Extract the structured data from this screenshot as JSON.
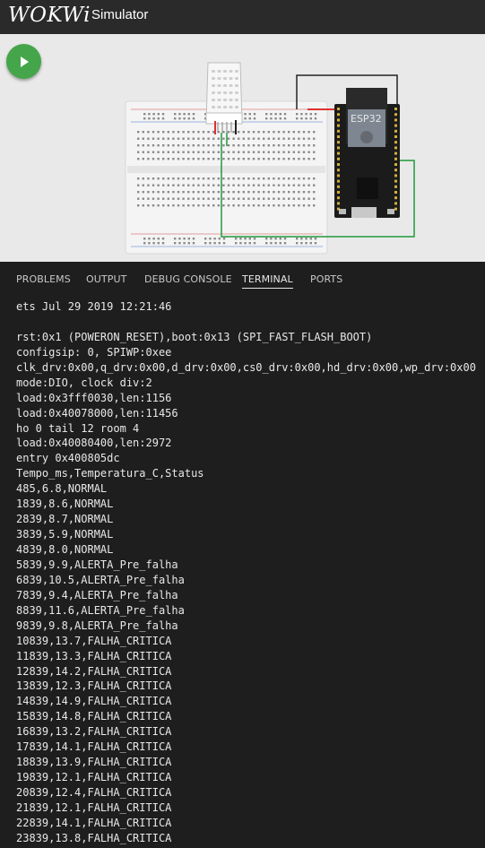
{
  "header": {
    "logo": "WOKWi",
    "title": "Simulator"
  },
  "colors": {
    "header_bg": "#2a2a2a",
    "canvas_bg": "#e9e9e9",
    "play_button": "#45a54a",
    "panel_bg": "#1e1e1e"
  },
  "canvas": {
    "play_icon": "play-icon",
    "esp32_label": "ESP32"
  },
  "tabs": [
    {
      "label": "PROBLEMS"
    },
    {
      "label": "OUTPUT"
    },
    {
      "label": "DEBUG CONSOLE"
    },
    {
      "label": "TERMINAL",
      "active": true
    },
    {
      "label": "PORTS"
    }
  ],
  "terminal": {
    "lines": [
      "ets Jul 29 2019 12:21:46",
      "",
      "rst:0x1 (POWERON_RESET),boot:0x13 (SPI_FAST_FLASH_BOOT)",
      "configsip: 0, SPIWP:0xee",
      "clk_drv:0x00,q_drv:0x00,d_drv:0x00,cs0_drv:0x00,hd_drv:0x00,wp_drv:0x00",
      "mode:DIO, clock div:2",
      "load:0x3fff0030,len:1156",
      "load:0x40078000,len:11456",
      "ho 0 tail 12 room 4",
      "load:0x40080400,len:2972",
      "entry 0x400805dc",
      "Tempo_ms,Temperatura_C,Status",
      "485,6.8,NORMAL",
      "1839,8.6,NORMAL",
      "2839,8.7,NORMAL",
      "3839,5.9,NORMAL",
      "4839,8.0,NORMAL",
      "5839,9.9,ALERTA_Pre_falha",
      "6839,10.5,ALERTA_Pre_falha",
      "7839,9.4,ALERTA_Pre_falha",
      "8839,11.6,ALERTA_Pre_falha",
      "9839,9.8,ALERTA_Pre_falha",
      "10839,13.7,FALHA_CRITICA",
      "11839,13.3,FALHA_CRITICA",
      "12839,14.2,FALHA_CRITICA",
      "13839,12.3,FALHA_CRITICA",
      "14839,14.9,FALHA_CRITICA",
      "15839,14.8,FALHA_CRITICA",
      "16839,13.2,FALHA_CRITICA",
      "17839,14.1,FALHA_CRITICA",
      "18839,13.9,FALHA_CRITICA",
      "19839,12.1,FALHA_CRITICA",
      "20839,12.4,FALHA_CRITICA",
      "21839,12.1,FALHA_CRITICA",
      "22839,14.1,FALHA_CRITICA",
      "23839,13.8,FALHA_CRITICA"
    ]
  }
}
